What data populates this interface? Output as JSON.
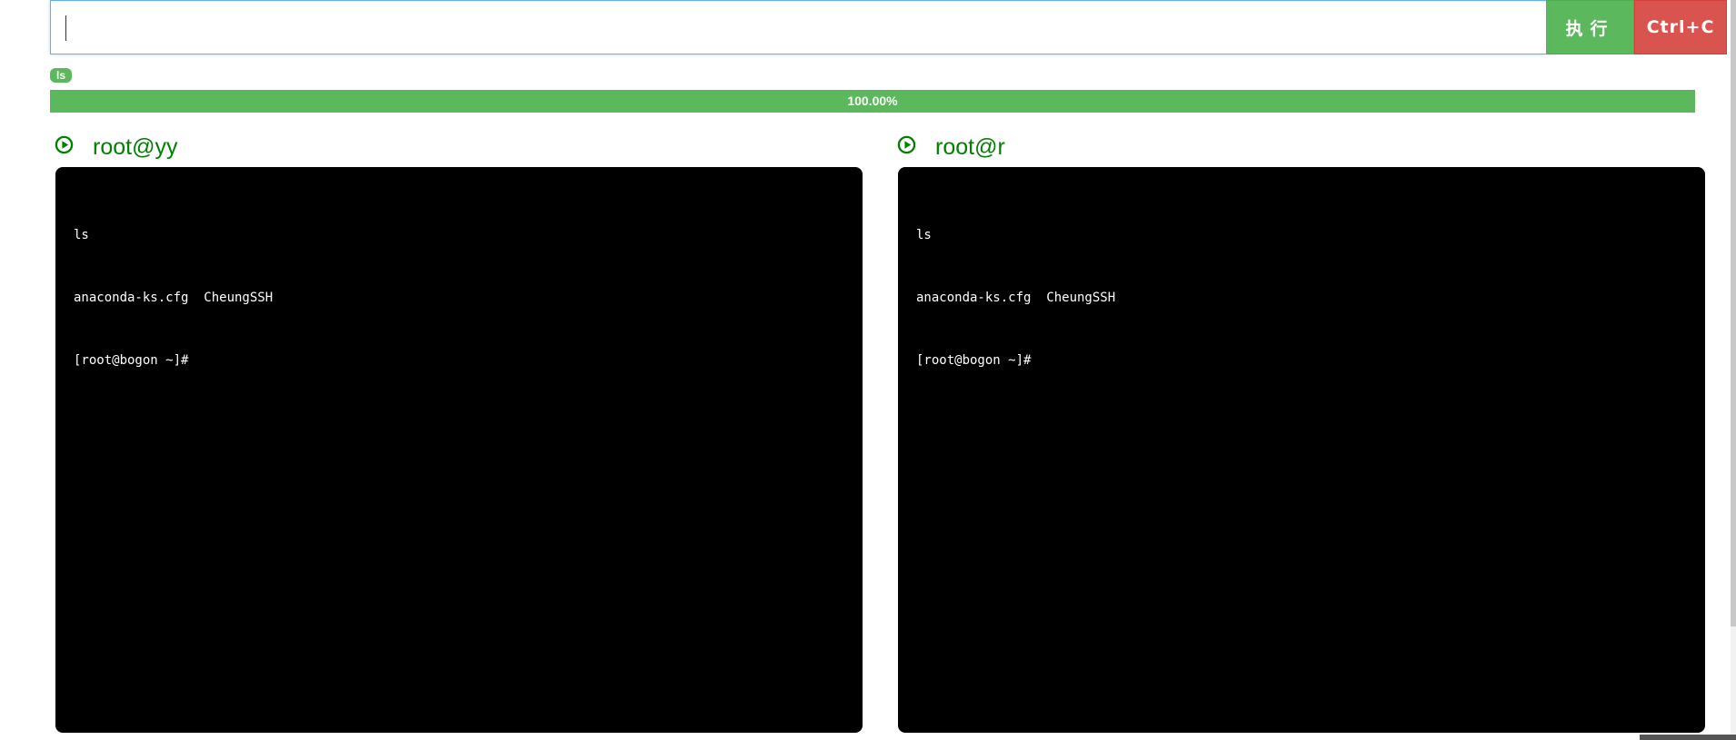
{
  "command": {
    "input_value": "",
    "exec_label": "执行",
    "ctrlc_label": "Ctrl+C"
  },
  "last_command_badge": "ls",
  "progress": {
    "value_percent": 100,
    "label": "100.00%"
  },
  "hosts": [
    {
      "title": "root@yy",
      "icon": "play-circle-icon",
      "terminal_lines": [
        "ls",
        "anaconda-ks.cfg  CheungSSH",
        "[root@bogon ~]#"
      ]
    },
    {
      "title": "root@r",
      "icon": "play-circle-icon",
      "terminal_lines": [
        "ls",
        "anaconda-ks.cfg  CheungSSH",
        "[root@bogon ~]#"
      ]
    }
  ],
  "colors": {
    "success": "#5cb85c",
    "danger": "#d9534f",
    "host_title": "#008000",
    "terminal_bg": "#000000",
    "terminal_fg": "#ffffff",
    "input_focus_border": "#66afe9"
  }
}
